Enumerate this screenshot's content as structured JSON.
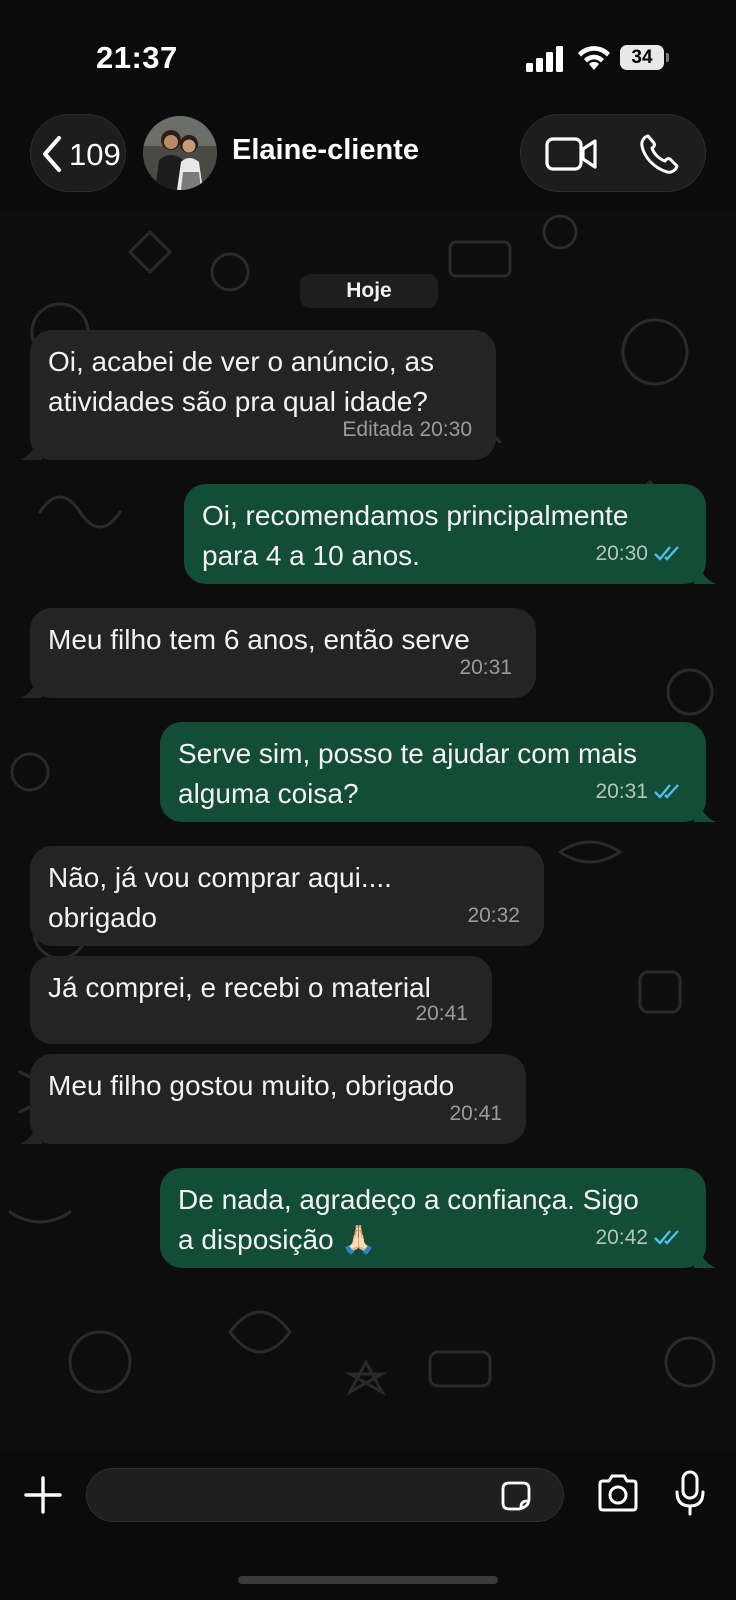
{
  "status_bar": {
    "time": "21:37",
    "battery": "34"
  },
  "header": {
    "back_count": "109",
    "contact_name": "Elaine-cliente"
  },
  "chat": {
    "date_separator": "Hoje",
    "messages": [
      {
        "direction": "in",
        "text": "Oi, acabei de ver o anúncio, as\natividades são pra qual idade?",
        "meta": "Editada 20:30"
      },
      {
        "direction": "out",
        "text": "Oi, recomendamos principalmente\npara 4 a 10 anos.",
        "meta": "20:30",
        "status": "read"
      },
      {
        "direction": "in",
        "text": "Meu filho tem 6 anos, então serve",
        "meta": "20:31"
      },
      {
        "direction": "out",
        "text": "Serve sim, posso te ajudar com mais\nalguma coisa?",
        "meta": "20:31",
        "status": "read"
      },
      {
        "direction": "in",
        "text": "Não, já vou comprar aqui....\nobrigado",
        "meta": "20:32"
      },
      {
        "direction": "in",
        "text": "Já comprei, e recebi o material",
        "meta": "20:41"
      },
      {
        "direction": "in",
        "text": "Meu filho gostou muito, obrigado",
        "meta": "20:41"
      },
      {
        "direction": "out",
        "text": "De nada, agradeço a confiança. Sigo\na disposição 🙏🏻",
        "meta": "20:42",
        "status": "read"
      }
    ]
  },
  "input_bar": {
    "placeholder": ""
  },
  "colors": {
    "incoming_bubble": "#242424",
    "outgoing_bubble": "#134d37",
    "read_ticks": "#53bdeb"
  },
  "icons": [
    "back-chevron-icon",
    "video-call-icon",
    "phone-call-icon",
    "plus-icon",
    "sticker-icon",
    "camera-icon",
    "microphone-icon",
    "read-receipt-icon"
  ]
}
